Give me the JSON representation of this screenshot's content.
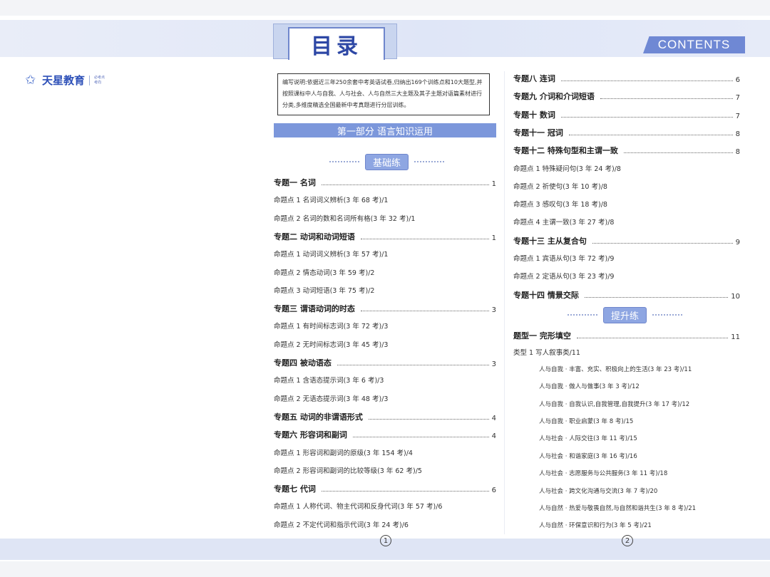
{
  "header": {
    "title": "目录",
    "contents_label": "CONTENTS",
    "logo_text": "天星教育",
    "logo_sub_1": "必考点",
    "logo_sub_2": "考向"
  },
  "notice": "编写说明:依据近三年250余套中考英语试卷,归纳出169个训练点和10大题型,并按照课标中人与自我、人与社会、人与自然三大主题及其子主题对语篇素材进行分类,多维度精选全国最新中考真题进行分层训练。",
  "part_one": "第一部分   语言知识运用",
  "sections": {
    "basic": "基础练",
    "advanced": "提升练"
  },
  "left_entries": [
    {
      "kind": "topic",
      "label": "专题一   名词",
      "page": "1"
    },
    {
      "kind": "sub",
      "label": "命题点 1   名词词义辨析(3 年 68 考)/1",
      "page": ""
    },
    {
      "kind": "sub",
      "label": "命题点 2   名词的数和名词所有格(3 年 32 考)/1",
      "page": ""
    },
    {
      "kind": "topic",
      "label": "专题二   动词和动词短语",
      "page": "1"
    },
    {
      "kind": "sub",
      "label": "命题点 1   动词词义辨析(3 年 57 考)/1",
      "page": ""
    },
    {
      "kind": "sub",
      "label": "命题点 2   情态动词(3 年 59 考)/2",
      "page": ""
    },
    {
      "kind": "sub",
      "label": "命题点 3   动词短语(3 年 75 考)/2",
      "page": ""
    },
    {
      "kind": "topic",
      "label": "专题三   谓语动词的时态",
      "page": "3"
    },
    {
      "kind": "sub",
      "label": "命题点 1   有时间标志词(3 年 72 考)/3",
      "page": ""
    },
    {
      "kind": "sub",
      "label": "命题点 2   无时间标志词(3 年 45 考)/3",
      "page": ""
    },
    {
      "kind": "topic",
      "label": "专题四   被动语态",
      "page": "3"
    },
    {
      "kind": "sub",
      "label": "命题点 1   含语态提示词(3 年 6 考)/3",
      "page": ""
    },
    {
      "kind": "sub",
      "label": "命题点 2   无语态提示词(3 年 48 考)/3",
      "page": ""
    },
    {
      "kind": "topic",
      "label": "专题五   动词的非谓语形式",
      "page": "4"
    },
    {
      "kind": "topic",
      "label": "专题六   形容词和副词",
      "page": "4"
    },
    {
      "kind": "sub",
      "label": "命题点 1   形容词和副词的原级(3 年 154 考)/4",
      "page": ""
    },
    {
      "kind": "sub",
      "label": "命题点 2   形容词和副词的比较等级(3 年 62 考)/5",
      "page": ""
    },
    {
      "kind": "topic",
      "label": "专题七   代词",
      "page": "6"
    },
    {
      "kind": "sub",
      "label": "命题点 1   人称代词、物主代词和反身代词(3 年 57 考)/6",
      "page": ""
    },
    {
      "kind": "sub",
      "label": "命题点 2   不定代词和指示代词(3 年 24 考)/6",
      "page": ""
    }
  ],
  "right_entries_top": [
    {
      "kind": "topic",
      "label": "专题八   连词",
      "page": "6"
    },
    {
      "kind": "topic",
      "label": "专题九   介词和介词短语",
      "page": "7"
    },
    {
      "kind": "topic",
      "label": "专题十   数词",
      "page": "7"
    },
    {
      "kind": "topic",
      "label": "专题十一   冠词",
      "page": "8"
    },
    {
      "kind": "topic",
      "label": "专题十二   特殊句型和主谓一致",
      "page": "8"
    },
    {
      "kind": "sub",
      "label": "命题点 1   特殊疑问句(3 年 24 考)/8",
      "page": ""
    },
    {
      "kind": "sub",
      "label": "命题点 2   祈使句(3 年 10 考)/8",
      "page": ""
    },
    {
      "kind": "sub",
      "label": "命题点 3   感叹句(3 年 18 考)/8",
      "page": ""
    },
    {
      "kind": "sub",
      "label": "命题点 4   主谓一致(3 年 27 考)/8",
      "page": ""
    },
    {
      "kind": "topic",
      "label": "专题十三   主从复合句",
      "page": "9"
    },
    {
      "kind": "sub",
      "label": "命题点 1   宾语从句(3 年 72 考)/9",
      "page": ""
    },
    {
      "kind": "sub",
      "label": "命题点 2   定语从句(3 年 23 考)/9",
      "page": ""
    },
    {
      "kind": "topic",
      "label": "专题十四   情景交际",
      "page": "10"
    }
  ],
  "right_entries_bottom": [
    {
      "kind": "topic",
      "label": "题型一   完形填空",
      "page": "11"
    },
    {
      "kind": "type",
      "label": "类型 1   写人叙事类/11",
      "page": ""
    },
    {
      "kind": "cat",
      "label": "人与自我 · 丰富、充实、积极向上的生活(3 年 23 考)/11",
      "page": ""
    },
    {
      "kind": "cat",
      "label": "人与自我 · 做人与做事(3 年 3 考)/12",
      "page": ""
    },
    {
      "kind": "cat",
      "label": "人与自我 · 自我认识,自我管理,自我提升(3 年 17 考)/12",
      "page": ""
    },
    {
      "kind": "cat",
      "label": "人与自我 · 职业启蒙(3 年 8 考)/15",
      "page": ""
    },
    {
      "kind": "cat",
      "label": "人与社会 · 人际交往(3 年 11 考)/15",
      "page": ""
    },
    {
      "kind": "cat",
      "label": "人与社会 · 和谐家庭(3 年 16 考)/16",
      "page": ""
    },
    {
      "kind": "cat",
      "label": "人与社会 · 志愿服务与公共服务(3 年 11 考)/18",
      "page": ""
    },
    {
      "kind": "cat",
      "label": "人与社会 · 跨文化沟通与交流(3 年 7 考)/20",
      "page": ""
    },
    {
      "kind": "cat",
      "label": "人与自然 · 热爱与敬畏自然,与自然和谐共生(3 年 8 考)/21",
      "page": ""
    },
    {
      "kind": "cat",
      "label": "人与自然 · 环保意识和行为(3 年 5 考)/21",
      "page": ""
    }
  ],
  "page_numbers": {
    "left": "1",
    "right": "2"
  },
  "colors": {
    "accent": "#6f88d4",
    "title": "#2d47a5",
    "band": "#e2e8f7"
  }
}
